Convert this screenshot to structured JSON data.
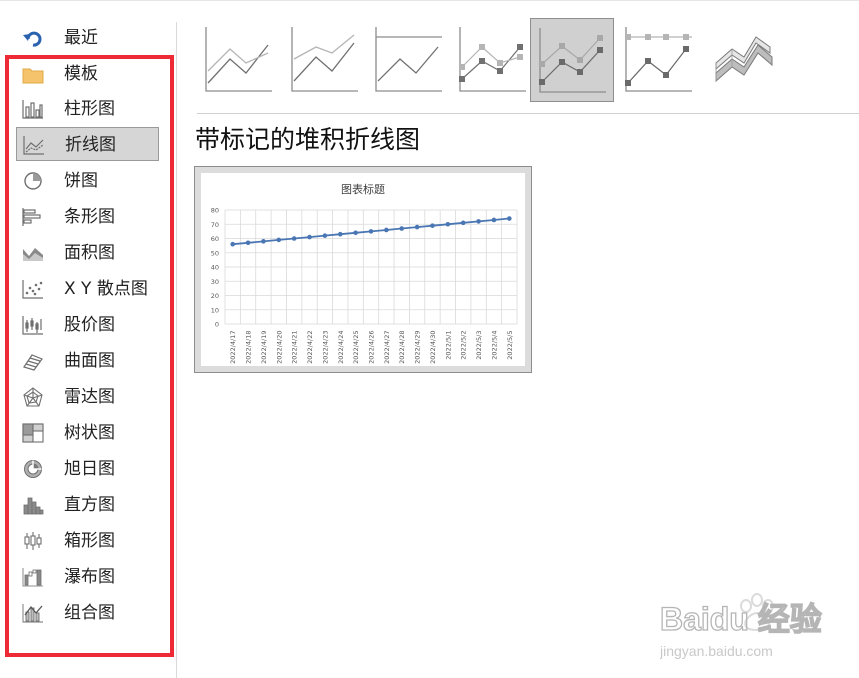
{
  "sidebar": {
    "items": [
      {
        "label": "最近",
        "icon": "undo-arrow-icon"
      },
      {
        "label": "模板",
        "icon": "folder-icon"
      },
      {
        "label": "柱形图",
        "icon": "column-chart-icon"
      },
      {
        "label": "折线图",
        "icon": "line-chart-icon",
        "selected": true
      },
      {
        "label": "饼图",
        "icon": "pie-chart-icon"
      },
      {
        "label": "条形图",
        "icon": "bar-chart-icon"
      },
      {
        "label": "面积图",
        "icon": "area-chart-icon"
      },
      {
        "label": "X Y 散点图",
        "icon": "scatter-chart-icon"
      },
      {
        "label": "股价图",
        "icon": "stock-chart-icon"
      },
      {
        "label": "曲面图",
        "icon": "surface-chart-icon"
      },
      {
        "label": "雷达图",
        "icon": "radar-chart-icon"
      },
      {
        "label": "树状图",
        "icon": "treemap-chart-icon"
      },
      {
        "label": "旭日图",
        "icon": "sunburst-chart-icon"
      },
      {
        "label": "直方图",
        "icon": "histogram-chart-icon"
      },
      {
        "label": "箱形图",
        "icon": "box-whisker-chart-icon"
      },
      {
        "label": "瀑布图",
        "icon": "waterfall-chart-icon"
      },
      {
        "label": "组合图",
        "icon": "combo-chart-icon"
      }
    ]
  },
  "subtypes": [
    {
      "icon": "line-icon"
    },
    {
      "icon": "stacked-line-icon"
    },
    {
      "icon": "100-stacked-line-icon"
    },
    {
      "icon": "line-with-markers-icon"
    },
    {
      "icon": "stacked-line-with-markers-icon",
      "selected": true
    },
    {
      "icon": "100-stacked-line-with-markers-icon"
    },
    {
      "icon": "3d-line-icon"
    }
  ],
  "selected_subtype_title": "带标记的堆积折线图",
  "colors": {
    "accent_red": "#ee2a36",
    "series": "#4a77b4",
    "selected_bg": "#d6d6d6"
  },
  "watermark": {
    "text": "Baidu 经验",
    "subtext": "jingyan.baidu.com"
  },
  "chart_data": {
    "type": "line",
    "title": "图表标题",
    "categories": [
      "2022/4/17",
      "2022/4/18",
      "2022/4/19",
      "2022/4/20",
      "2022/4/21",
      "2022/4/22",
      "2022/4/23",
      "2022/4/24",
      "2022/4/25",
      "2022/4/26",
      "2022/4/27",
      "2022/4/28",
      "2022/4/29",
      "2022/4/30",
      "2022/5/1",
      "2022/5/2",
      "2022/5/3",
      "2022/5/4",
      "2022/5/5"
    ],
    "series": [
      {
        "values": [
          56,
          57,
          58,
          59,
          60,
          61,
          62,
          63,
          64,
          65,
          66,
          67,
          68,
          69,
          70,
          71,
          72,
          73,
          74
        ]
      }
    ],
    "ylim": [
      0,
      80
    ],
    "yticks": [
      0,
      10,
      20,
      30,
      40,
      50,
      60,
      70,
      80
    ],
    "grid": true,
    "markers": true
  }
}
